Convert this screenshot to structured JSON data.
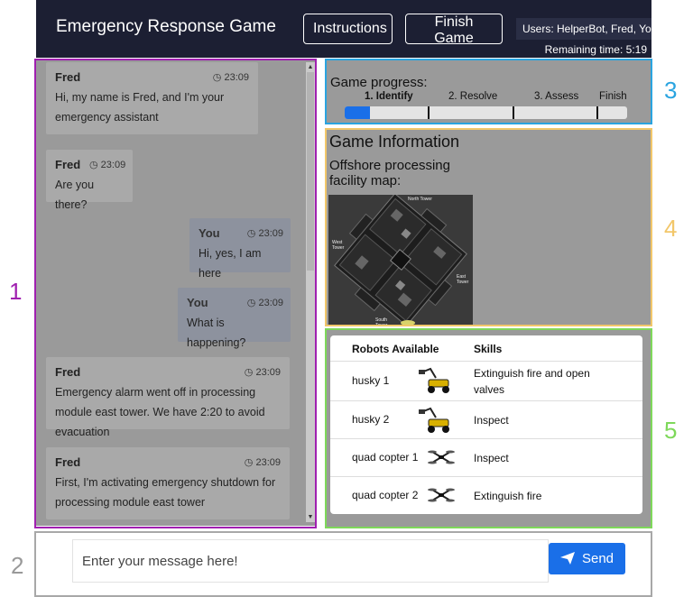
{
  "header": {
    "title": "Emergency Response Game",
    "instructions_label": "Instructions",
    "finish_label": "Finish Game",
    "users": "Users: HelperBot, Fred, You",
    "remaining": "Remaining time: 5:19"
  },
  "chat": {
    "messages": [
      {
        "sender": "Fred",
        "time": "23:09",
        "text": "Hi, my name is Fred, and I'm your emergency assistant"
      },
      {
        "sender": "Fred",
        "time": "23:09",
        "text": "Are you there?"
      },
      {
        "sender": "You",
        "time": "23:09",
        "text": "Hi, yes, I am here"
      },
      {
        "sender": "You",
        "time": "23:09",
        "text": "What is happening?"
      },
      {
        "sender": "Fred",
        "time": "23:09",
        "text": "Emergency alarm went off in processing module east tower. We have 2:20 to avoid evacuation"
      },
      {
        "sender": "Fred",
        "time": "23:09",
        "text": "First, I'm activating emergency shutdown for processing module east tower"
      }
    ]
  },
  "progress": {
    "title": "Game progress:",
    "steps": [
      "1. Identify",
      "2. Resolve",
      "3. Assess",
      "Finish"
    ],
    "active_step": 0,
    "fill_percent": 9
  },
  "info": {
    "title": "Game Information",
    "subtitle": "Offshore processing facility map:",
    "towers": [
      "North Tower",
      "West Tower",
      "East Tower",
      "South Tower"
    ]
  },
  "robots": {
    "header_robots": "Robots Available",
    "header_skills": "Skills",
    "rows": [
      {
        "name": "husky 1",
        "icon": "husky-robot-icon",
        "skill": "Extinguish fire and open valves"
      },
      {
        "name": "husky 2",
        "icon": "husky-robot-icon",
        "skill": "Inspect"
      },
      {
        "name": "quad copter 1",
        "icon": "quadcopter-icon",
        "skill": "Inspect"
      },
      {
        "name": "quad copter 2",
        "icon": "quadcopter-icon",
        "skill": "Extinguish fire"
      }
    ]
  },
  "input": {
    "placeholder": "Enter your message here!",
    "send_label": "Send"
  },
  "section_numbers": [
    "1",
    "2",
    "3",
    "4",
    "5"
  ],
  "colors": {
    "header_bg": "#1c1f33",
    "accent_blue": "#1a6fe8",
    "box1": "#a020b0",
    "box2": "#a8a8a8",
    "box3": "#2aa4e0",
    "box4": "#f2c76a",
    "box5": "#7ed85a"
  }
}
